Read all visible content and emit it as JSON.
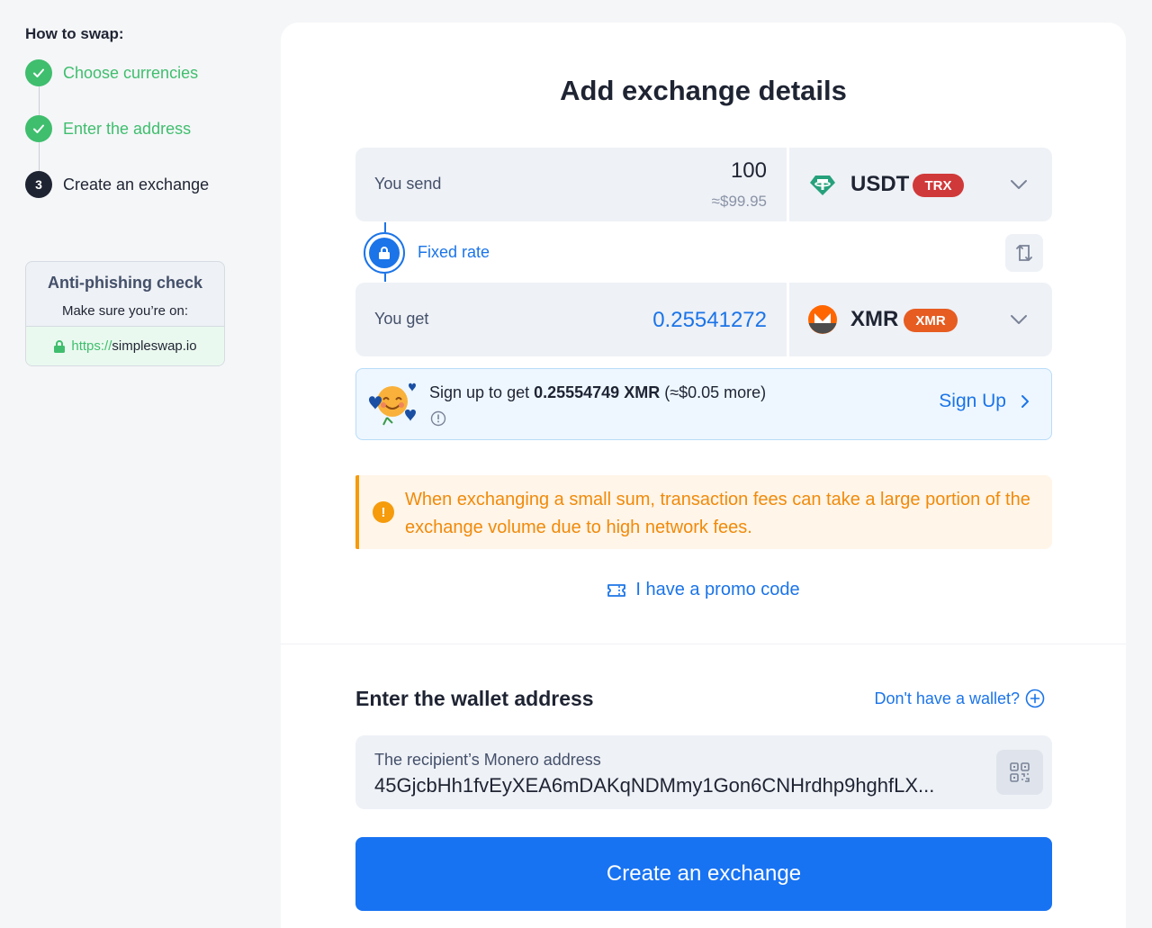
{
  "sidebar": {
    "title": "How to swap:",
    "steps": [
      {
        "label": "Choose currencies",
        "state": "done"
      },
      {
        "label": "Enter the address",
        "state": "done"
      },
      {
        "label": "Create an exchange",
        "state": "current",
        "number": "3"
      }
    ],
    "anti_phishing": {
      "title": "Anti-phishing check",
      "subtitle": "Make sure you’re on:",
      "url_protocol": "https://",
      "url_host": "simpleswap.io"
    }
  },
  "main": {
    "title": "Add exchange details",
    "send": {
      "label": "You send",
      "amount": "100",
      "usd_estimate": "≈$99.95",
      "currency": "USDT",
      "network": "TRX",
      "icon": "tether-icon"
    },
    "rate": {
      "label": "Fixed rate"
    },
    "get": {
      "label": "You get",
      "amount": "0.25541272",
      "currency": "XMR",
      "network": "XMR",
      "icon": "monero-icon"
    },
    "signup_banner": {
      "prefix": "Sign up to get ",
      "bonus": "0.25554749 XMR",
      "suffix": " (≈$0.05 more)",
      "button": "Sign Up"
    },
    "warning": {
      "text": "When exchanging a small sum, transaction fees can take a large portion of the exchange volume due to high network fees."
    },
    "promo": {
      "label": "I have a promo code"
    }
  },
  "wallet": {
    "title": "Enter the wallet address",
    "no_wallet_link": "Don't have a wallet?",
    "address_label": "The recipient’s Monero address",
    "address_value": "45GjcbHh1fvEyXEA6mDAKqNDMmy1Gon6CNHrdhp9hghfLX...",
    "submit": "Create an exchange"
  },
  "colors": {
    "accent": "#1b74e8",
    "success": "#3fbe6e",
    "warning": "#f59b0c",
    "trx_badge": "#d0393a",
    "xmr_badge": "#e65c21"
  }
}
